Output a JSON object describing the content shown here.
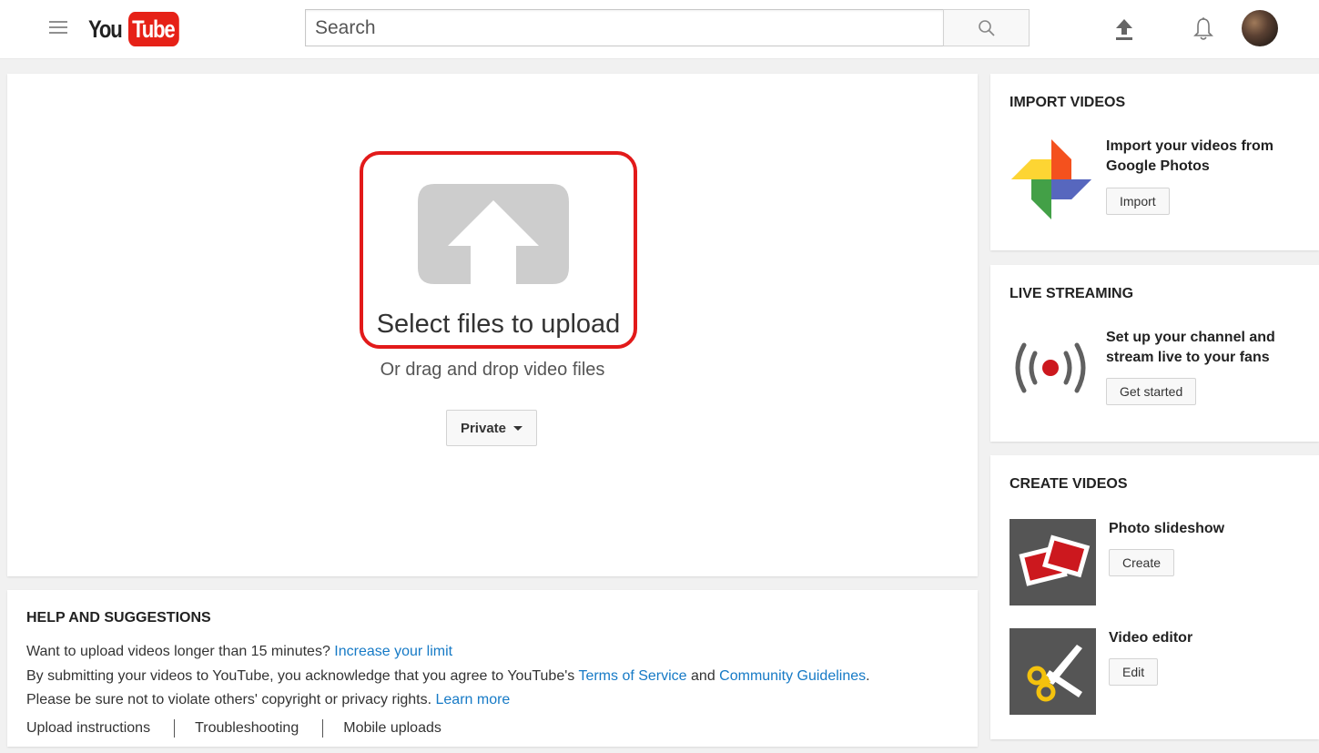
{
  "header": {
    "logo_you": "You",
    "logo_tube": "Tube",
    "search_placeholder": "Search",
    "icons": [
      "menu-icon",
      "search-icon",
      "upload-icon",
      "bell-icon",
      "avatar"
    ]
  },
  "upload": {
    "select_label": "Select files to upload",
    "drag_label": "Or drag and drop video files",
    "privacy_value": "Private"
  },
  "help": {
    "title": "HELP AND SUGGESTIONS",
    "line1_text": "Want to upload videos longer than 15 minutes? ",
    "line1_link": "Increase your limit",
    "line2_text": "By submitting your videos to YouTube, you acknowledge that you agree to YouTube's ",
    "line2_link1": "Terms of Service",
    "line2_and": " and ",
    "line2_link2": "Community Guidelines",
    "line2_end": ".",
    "line3_text": "Please be sure not to violate others' copyright or privacy rights. ",
    "line3_link": "Learn more",
    "links": [
      "Upload instructions",
      "Troubleshooting",
      "Mobile uploads"
    ]
  },
  "sidebar": {
    "import": {
      "title": "IMPORT VIDEOS",
      "text": "Import your videos from Google Photos",
      "button": "Import"
    },
    "live": {
      "title": "LIVE STREAMING",
      "text": "Set up your channel and stream live to your fans",
      "button": "Get started"
    },
    "create": {
      "title": "CREATE VIDEOS",
      "slideshow_label": "Photo slideshow",
      "slideshow_button": "Create",
      "editor_label": "Video editor",
      "editor_button": "Edit"
    }
  },
  "colors": {
    "accent_red": "#e62117",
    "highlight_red": "#e21a1a",
    "link_blue": "#167ac6",
    "live_red": "#cc181e"
  }
}
